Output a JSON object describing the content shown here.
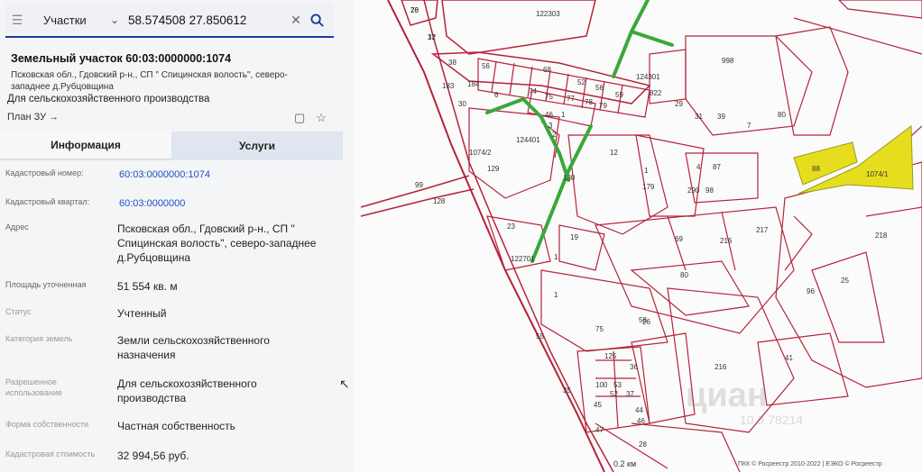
{
  "search": {
    "category": "Участки",
    "query": "58.574508 27.850612"
  },
  "card": {
    "title": "Земельный участок 60:03:0000000:1074",
    "address_short": "Псковская обл., Гдовский р-н., СП \" Спицинская волость\", северо-западнее д.Рубцовщина",
    "purpose": "Для сельскохозяйственного производства",
    "plan_link": "План ЗУ →"
  },
  "tabs": [
    "Информация",
    "Услуги"
  ],
  "fields": [
    {
      "label": "Кадастровый номер:",
      "value": "60:03:0000000:1074"
    },
    {
      "label": "Кадастровый квартал:",
      "value": "60:03:0000000"
    },
    {
      "label": "Адрес",
      "value": "Псковская обл., Гдовский р-н., СП \" Спицинская волость\", северо-западнее д.Рубцовщина"
    },
    {
      "label": "Площадь уточненная",
      "value": "51 554 кв. м"
    },
    {
      "label": "Статус",
      "value": "Учтенный"
    },
    {
      "label": "Категория земель",
      "value": "Земли сельскохозяйственного назначения"
    },
    {
      "label": "Разрешенное использование",
      "value": "Для сельскохозяйственного производства"
    },
    {
      "label": "Форма собственности",
      "value": "Частная собственность"
    },
    {
      "label": "Кадастровая стоимость",
      "value": "32 994,56 руб."
    }
  ],
  "map": {
    "scale": "0.2 км",
    "copyright": "ПКК © Росреестр 2010-2022 | ЕЭКО © Росреестр",
    "watermark": "циан",
    "watermark_id": "10 9 78214",
    "highlight_color": "#e6dd1f",
    "parcel_color": "#b5233a",
    "road_color": "#3aa83a",
    "labels": [
      "20",
      "37",
      "122303",
      "998",
      "38",
      "56",
      "68",
      "124301",
      "183",
      "184",
      "30",
      "74",
      "75",
      "52",
      "56",
      "59",
      "822",
      "29",
      "31",
      "39",
      "80",
      "77",
      "78",
      "79",
      "6",
      "46",
      "1",
      "3",
      "7",
      "124401",
      "2",
      "12",
      "1",
      "4",
      "87",
      "88",
      "1074/1",
      "1074/2",
      "129",
      "179",
      "290",
      "98",
      "99",
      "128",
      "130",
      "23",
      "19",
      "69",
      "216",
      "217",
      "218",
      "1",
      "122701",
      "80",
      "96",
      "25",
      "26",
      "75",
      "58",
      "55",
      "125",
      "35",
      "100",
      "53",
      "36",
      "45",
      "52",
      "37",
      "44",
      "46",
      "47",
      "41",
      "216",
      "28",
      "1",
      "78",
      "12"
    ]
  }
}
